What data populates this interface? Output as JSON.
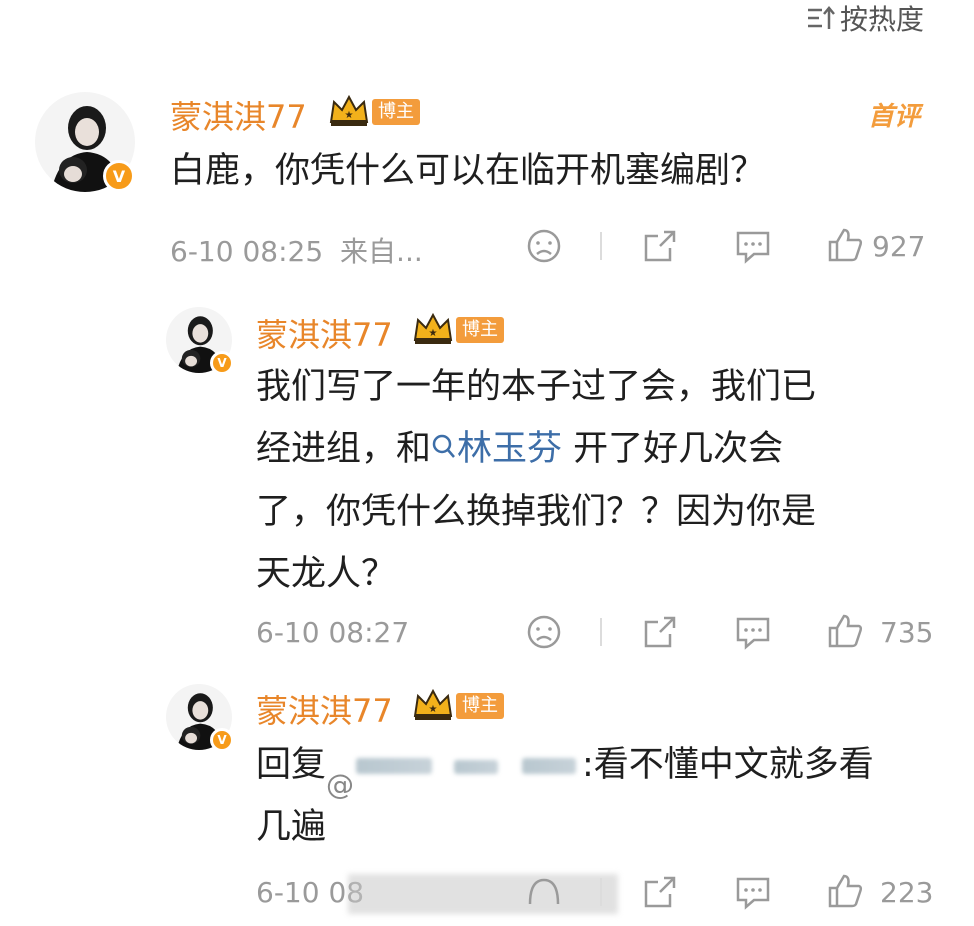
{
  "sort": {
    "label": "按热度",
    "icon": "sort-icon"
  },
  "comments": [
    {
      "author": "蒙淇淇77",
      "badge": "博主",
      "first_badge": "首评",
      "text_lines": [
        "白鹿，你凭什么可以在临开机塞编剧？"
      ],
      "time": "6-10 08:25",
      "source": "来自...",
      "likes": "927"
    },
    {
      "author": "蒙淇淇77",
      "badge": "博主",
      "text_line1": "我们写了一年的本子过了会，我们已",
      "text_line2_pre": "经进组，和",
      "topic": "林玉芬",
      "text_line2_post": " 开了好几次会",
      "text_line3": "了，你凭什么换掉我们？？因为你是",
      "text_line4": "天龙人？",
      "time": "6-10 08:27",
      "likes": "735"
    },
    {
      "author": "蒙淇淇77",
      "badge": "博主",
      "reply_prefix": "回复",
      "reply_suffix": ":看不懂中文就多看",
      "text_line2": "几遍",
      "time": "6-10 08",
      "likes": "223"
    }
  ],
  "colors": {
    "accent": "#e8862a",
    "badge_bg": "#f39c3c",
    "link": "#3d6ea8",
    "meta": "#9a9a9a"
  }
}
